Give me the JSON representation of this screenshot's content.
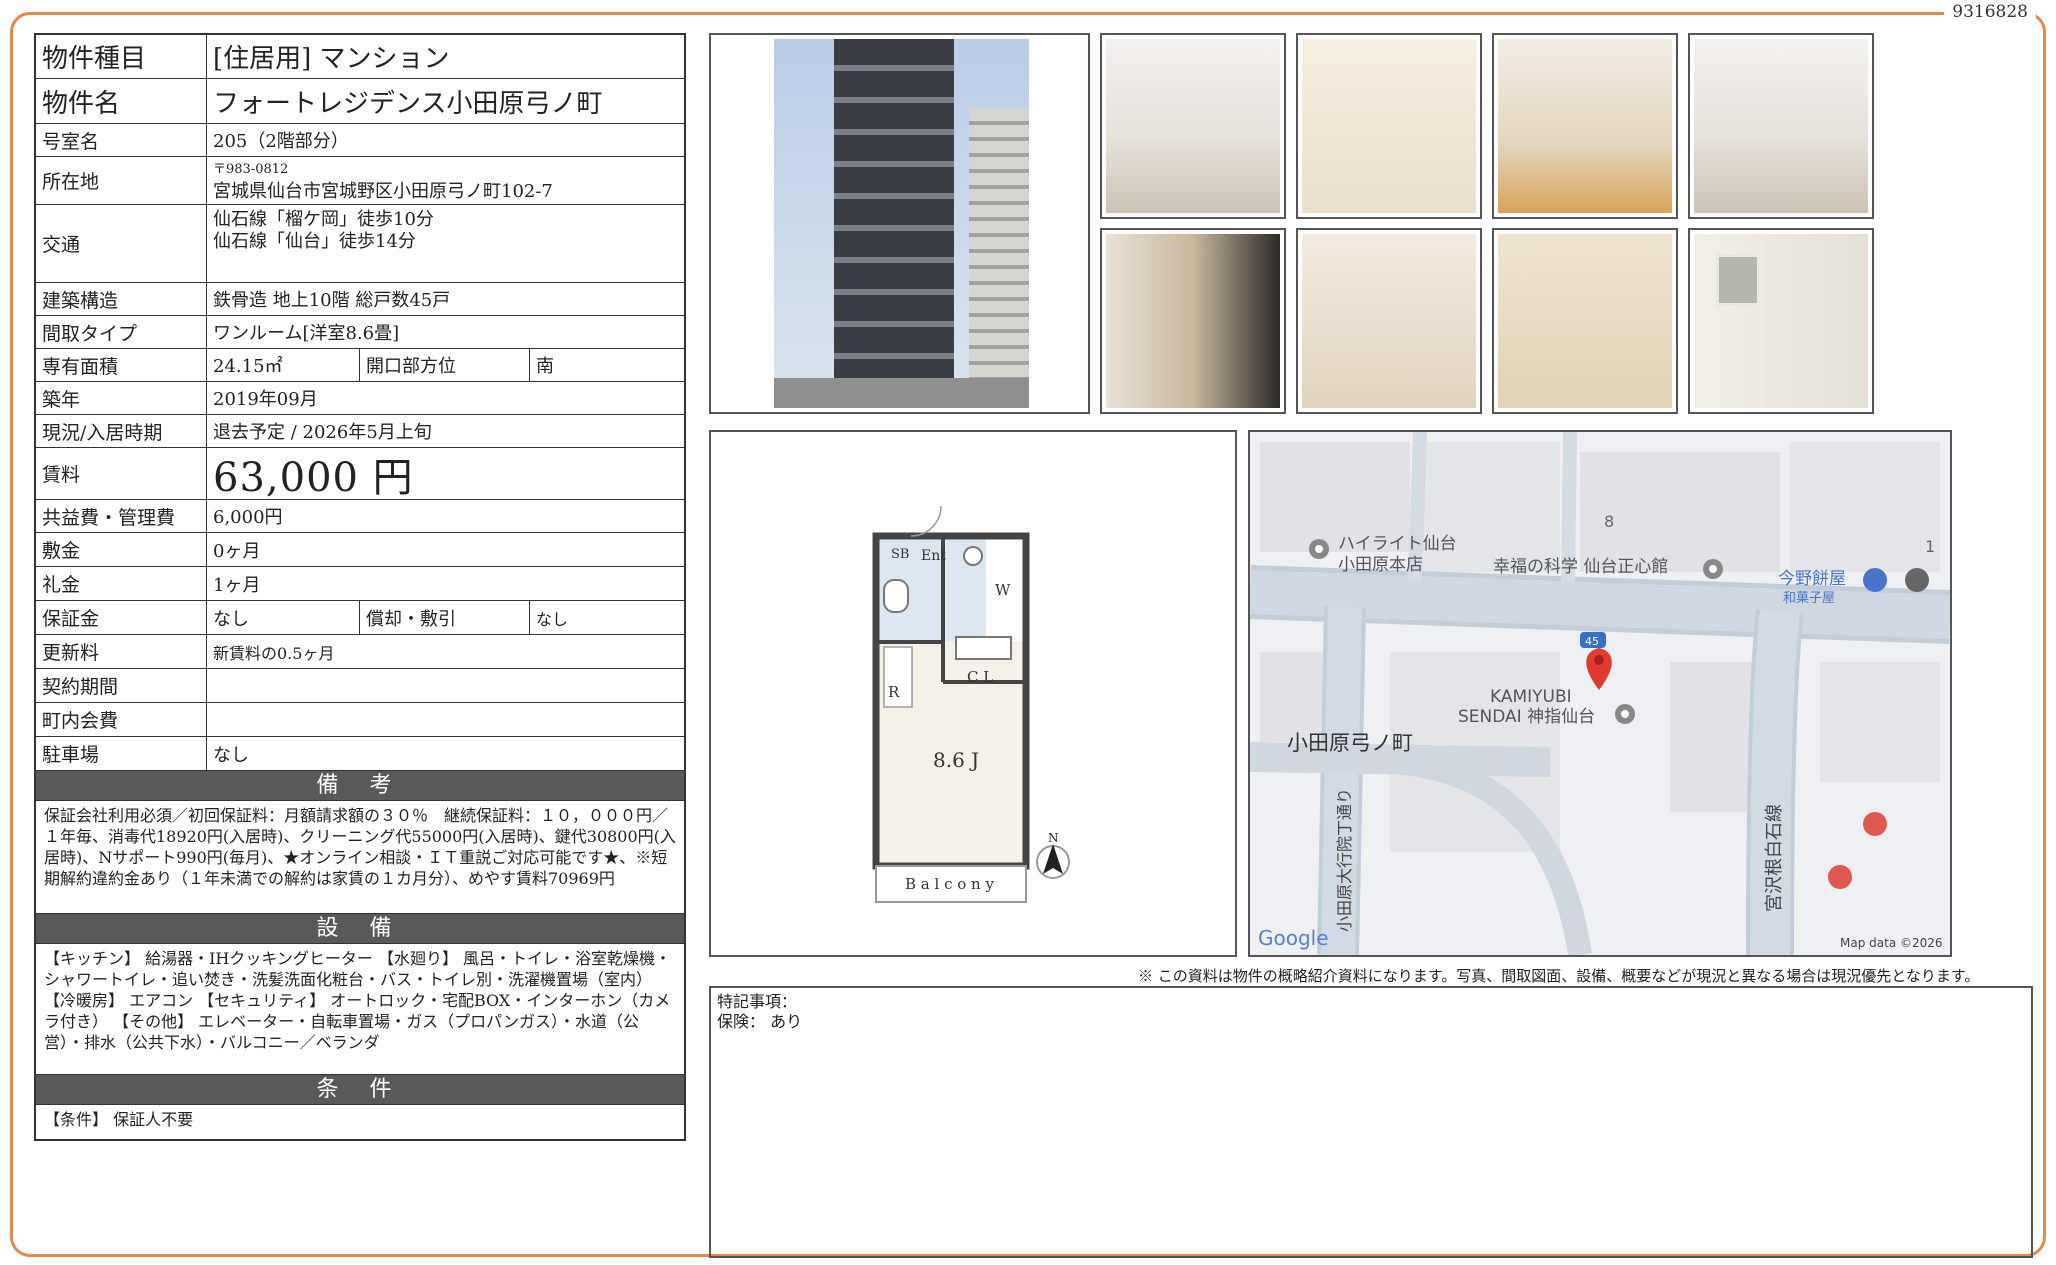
{
  "property_id": "9316828",
  "spec": {
    "type_label": "物件種目",
    "type_value": "[住居用]  マンション",
    "name_label": "物件名",
    "name_value": "フォートレジデンス小田原弓ノ町",
    "room_label": "号室名",
    "room_value": "205（2階部分）",
    "address_label": "所在地",
    "address_zip": "〒983-0812",
    "address_value": "宮城県仙台市宮城野区小田原弓ノ町102-7",
    "transport_label": "交通",
    "transport_line1": "仙石線「榴ケ岡」徒歩10分",
    "transport_line2": "仙石線「仙台」徒歩14分",
    "structure_label": "建築構造",
    "structure_value": "鉄骨造 地上10階 総戸数45戸",
    "layout_label": "間取タイプ",
    "layout_value": "ワンルーム[洋室8.6畳]",
    "area_label": "専有面積",
    "area_value": "24.15㎡",
    "orientation_label": "開口部方位",
    "orientation_value": "南",
    "built_label": "築年",
    "built_value": "2019年09月",
    "status_label": "現況/入居時期",
    "status_value": "退去予定 /  2026年5月上旬",
    "rent_label": "賃料",
    "rent_value": "63,000 円",
    "fee_label": "共益費・管理費",
    "fee_value": "6,000円",
    "deposit_label": "敷金",
    "deposit_value": "0ヶ月",
    "key_money_label": "礼金",
    "key_money_value": "1ヶ月",
    "guarantee_label": "保証金",
    "guarantee_value": "なし",
    "amortization_label": "償却・敷引",
    "amortization_value": "なし",
    "renewal_label": "更新料",
    "renewal_value": "新賃料の0.5ヶ月",
    "contract_label": "契約期間",
    "contract_value": "",
    "association_label": "町内会費",
    "association_value": "",
    "parking_label": "駐車場",
    "parking_value": "なし"
  },
  "remarks": {
    "heading": "備  考",
    "text": "保証会社利用必須／初回保証料：月額請求額の３０％　継続保証料：１０，０００円／１年毎、消毒代18920円(入居時)、クリーニング代55000円(入居時)、鍵代30800円(入居時)、Nサポート990円(毎月)、★オンライン相談・ＩＴ重説ご対応可能です★、※短期解約違約金あり（１年未満での解約は家賃の１カ月分）、めやす賃料70969円"
  },
  "facilities": {
    "heading": "設  備",
    "text": "【キッチン】 給湯器・IHクッキングヒーター 【水廻り】 風呂・トイレ・浴室乾燥機・シャワートイレ・追い焚き・洗髪洗面化粧台・バス・トイレ別・洗濯機置場（室内） 【冷暖房】 エアコン 【セキュリティ】 オートロック・宅配BOX・インターホン（カメラ付き） 【その他】 エレベーター・自転車置場・ガス（プロパンガス）・水道（公営）・排水（公共下水）・バルコニー／ベランダ"
  },
  "conditions": {
    "heading": "条  件",
    "text": "【条件】 保証人不要"
  },
  "floorplan": {
    "sb": "SB",
    "ent": "Ent",
    "w": "W",
    "cl": "C L",
    "r": "R",
    "room": "8.6 J",
    "balcony": "B a l c o n y",
    "north": "N"
  },
  "map": {
    "poi_1": "ハイライト仙台",
    "poi_1b": "小田原本店",
    "poi_2": "幸福の科学 仙台正心館",
    "poi_3": "今野餅屋",
    "poi_3b": "和菓子屋",
    "poi_4": "KAMIYUBI",
    "poi_4b": "SENDAI 神指仙台",
    "area": "小田原弓ノ町",
    "road_1": "小田原大行院丁通り",
    "road_2": "宮沢根白石線",
    "block_8": "8",
    "block_1": "1",
    "route": "45",
    "google": "Google",
    "attribution": "Map data ©2026"
  },
  "disclaimer": "※ この資料は物件の概略紹介資料になります。写真、間取図面、設備、概要などが現況と異なる場合は現況優先となります。",
  "notes": {
    "line1": "特記事項：",
    "line2": "保険：  あり"
  }
}
